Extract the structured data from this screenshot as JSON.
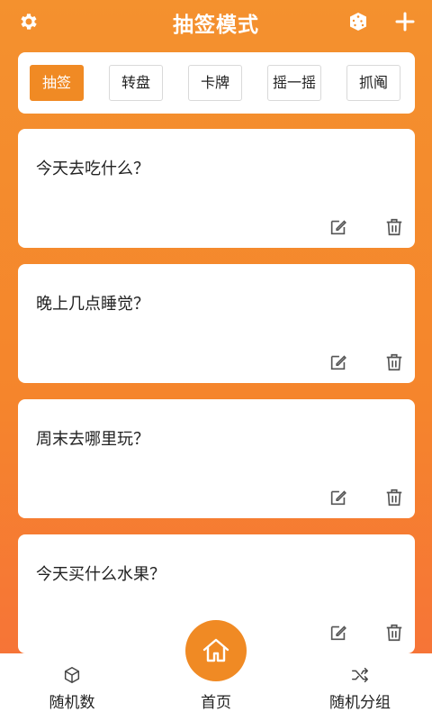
{
  "header": {
    "title": "抽签模式"
  },
  "tabs": [
    {
      "label": "抽签",
      "active": true
    },
    {
      "label": "转盘",
      "active": false
    },
    {
      "label": "卡牌",
      "active": false
    },
    {
      "label": "摇一摇",
      "active": false
    },
    {
      "label": "抓阄",
      "active": false
    }
  ],
  "cards": [
    {
      "question": "今天去吃什么？"
    },
    {
      "question": "晚上几点睡觉？"
    },
    {
      "question": "周末去哪里玩？"
    },
    {
      "question": "今天买什么水果？"
    }
  ],
  "bottom_nav": {
    "random_number": "随机数",
    "home": "首页",
    "random_group": "随机分组"
  },
  "colors": {
    "accent": "#F08A24",
    "background_top": "#F4912E",
    "background_bottom": "#F6703A"
  }
}
